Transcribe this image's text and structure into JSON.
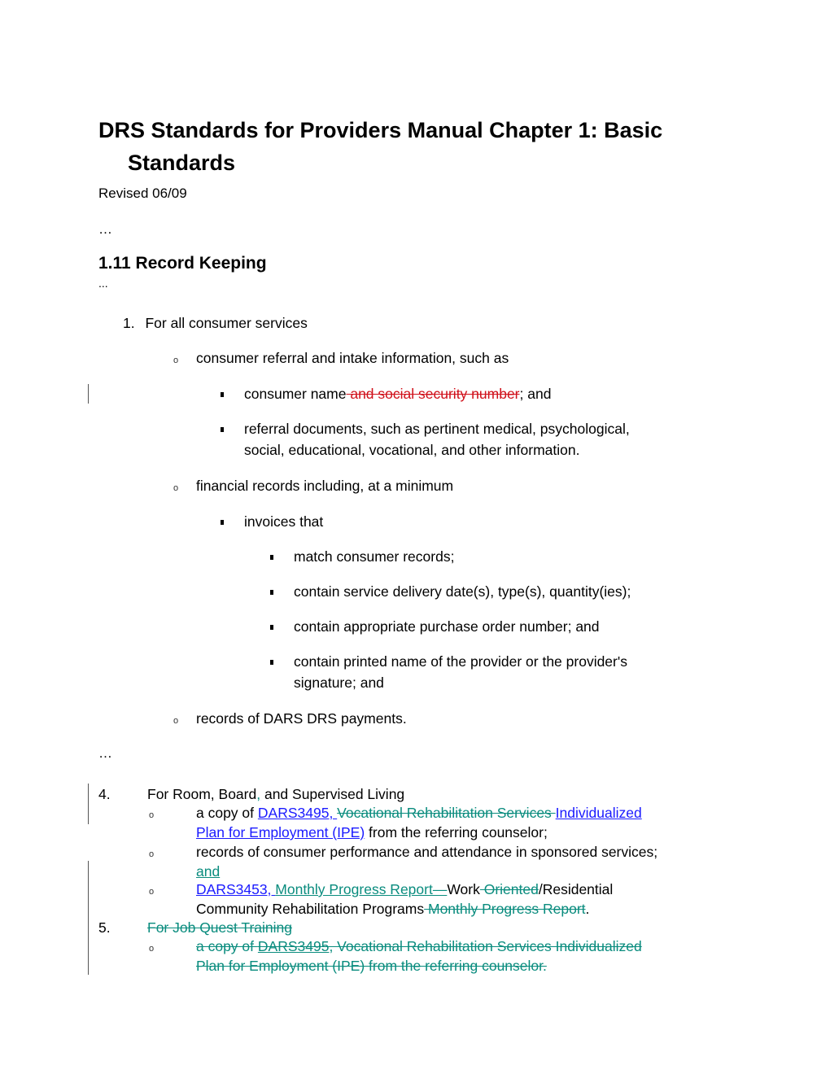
{
  "document": {
    "title_line1": "DRS Standards for Providers Manual Chapter 1: Basic",
    "title_line2": "Standards",
    "revised": "Revised 06/09",
    "ellipsis_top": "…",
    "section_heading": "1.11 Record Keeping",
    "ellipsis_section": "...",
    "item1": {
      "number": "1.",
      "label": "For all consumer services",
      "sub_a": {
        "bullet": "o",
        "text": "consumer referral and intake information, such as",
        "items": [
          {
            "text_pre": "consumer name",
            "deleted": " and social security number",
            "text_post": "; and"
          },
          {
            "line1": "referral documents, such as pertinent medical, psychological,",
            "line2": "social, educational, vocational, and other information."
          }
        ]
      },
      "sub_b": {
        "bullet": "o",
        "text": "financial records including, at a minimum",
        "invoices_label": "invoices that",
        "invoice_items": [
          "match consumer records;",
          "contain service delivery date(s), type(s), quantity(ies);",
          "contain appropriate purchase order number; and"
        ],
        "invoice_last_line1": "contain printed name of the provider or the provider's",
        "invoice_last_line2": "signature; and"
      },
      "sub_c": {
        "bullet": "o",
        "text": "records of DARS DRS payments."
      }
    },
    "ellipsis_mid": "…",
    "item4": {
      "number": "4.",
      "label_pre": "For Room, Board",
      "label_ins": ",",
      "label_post": " and Supervised Living",
      "sub_a": {
        "pre": "a copy of ",
        "link1": "DARS3495, ",
        "deleted": "Vocational Rehabilitation Services ",
        "link2": "Individualized ",
        "link3": "Plan for Employment (IPE)",
        "post": " from the referring counselor;"
      },
      "sub_b": {
        "text": "records of consumer performance and attendance in sponsored services;",
        "ins": "and"
      },
      "sub_c": {
        "link": "DARS3453, ",
        "ins": "Monthly Progress Report—",
        "text1": "Work",
        "deleted1": " Oriented",
        "text2": "/Residential",
        "line2": "Community Rehabilitation Programs",
        "deleted2": " Monthly Progress Report",
        "end": "."
      }
    },
    "item5": {
      "number": "5.",
      "label_deleted": "For Job Quest Training ",
      "sub_a_line1_pre": "a copy of ",
      "sub_a_line1_link": "DARS3495",
      "sub_a_line1_post": ", Vocational Rehabilitation Services Individualized ",
      "sub_a_line2": "Plan for Employment (IPE) from the referring counselor. "
    },
    "colors": {
      "deleted_red": "#d0101a",
      "track_teal": "#0a8c7e",
      "link_blue": "#1a1aff"
    }
  }
}
